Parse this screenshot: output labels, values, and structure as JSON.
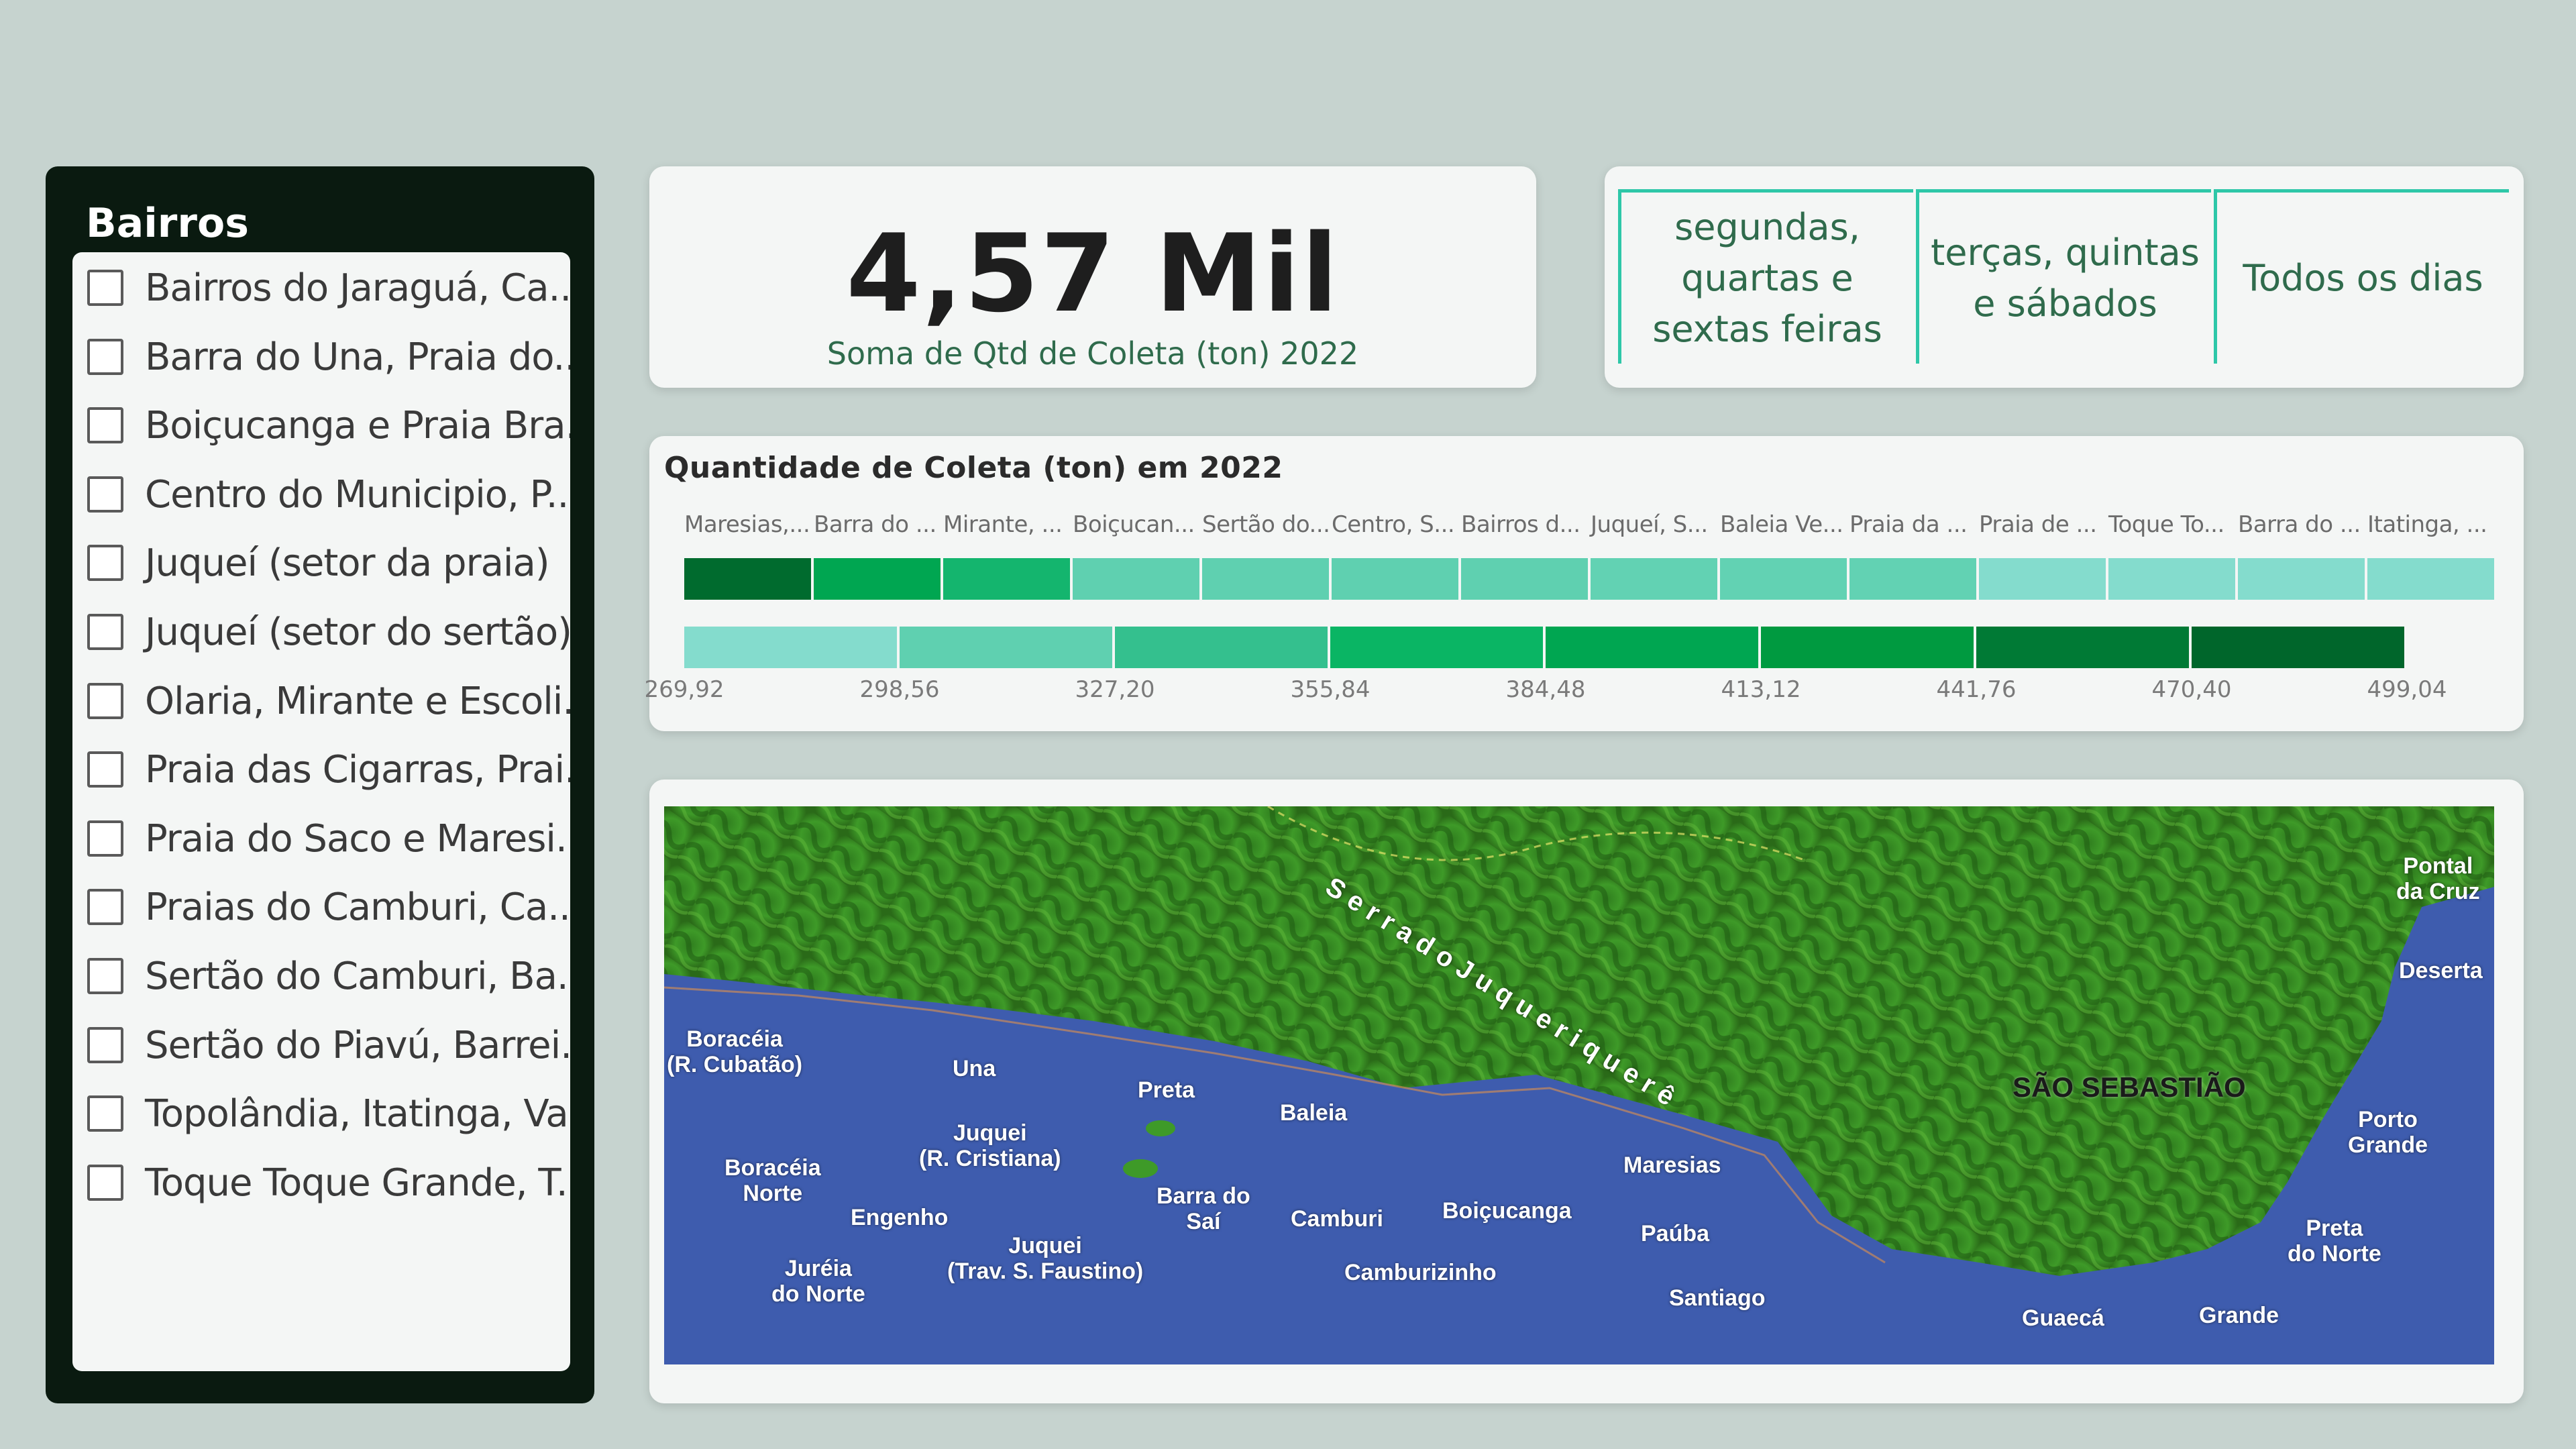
{
  "slicer": {
    "title": "Bairros",
    "items": [
      "Bairros do Jaraguá, Ca...",
      "Barra do Una, Praia do...",
      "Boiçucanga e Praia Bra...",
      "Centro do Municipio, P...",
      "Juqueí (setor da praia)",
      "Juqueí (setor do sertão)",
      "Olaria, Mirante e Escoli...",
      "Praia das Cigarras, Prai...",
      "Praia do Saco e Maresi...",
      "Praias do Camburi, Ca...",
      "Sertão do Camburi, Ba...",
      "Sertão do Piavú, Barrei...",
      "Topolândia, Itatinga, Va...",
      "Toque Toque Grande, T..."
    ]
  },
  "kpi": {
    "value": "4,57 Mil",
    "label": "Soma de Qtd de Coleta (ton) 2022"
  },
  "days": {
    "buttons": [
      "segundas,\nquartas e\nsextas feiras",
      "terças, quintas\ne sábados",
      "Todos os dias"
    ]
  },
  "heatmap": {
    "title": "Quantidade de Coleta (ton) em 2022",
    "categories": [
      "Maresias,...",
      "Barra do ...",
      "Mirante, ...",
      "Boiçucan...",
      "Sertão do...",
      "Centro, S...",
      "Bairros d...",
      "Juqueí, S...",
      "Baleia Ve...",
      "Praia da ...",
      "Praia de ...",
      "Toque To...",
      "Barra do ...",
      "Itatinga, ..."
    ],
    "cell_colors": [
      "#006b2e",
      "#00a651",
      "#14b56e",
      "#5fd0b0",
      "#5fd0b0",
      "#5fd0b0",
      "#5fd0b0",
      "#62d2b3",
      "#62d2b3",
      "#62d2b3",
      "#84dccd",
      "#84dccd",
      "#84dccd",
      "#84dccd"
    ],
    "legend_colors": [
      "#84dccd",
      "#5fd0b0",
      "#34c08e",
      "#0ab564",
      "#00a651",
      "#009a40",
      "#007a35",
      "#00662b"
    ],
    "legend_ticks": [
      "269,92",
      "298,56",
      "327,20",
      "355,84",
      "384,48",
      "413,12",
      "441,76",
      "470,40",
      "499,04"
    ]
  },
  "map": {
    "labels": [
      {
        "id": "boraceia-cubatao",
        "text": "Boracéia\n(R. Cubatão)"
      },
      {
        "id": "una",
        "text": "Una"
      },
      {
        "id": "boraceia-norte",
        "text": "Boracéia\nNorte"
      },
      {
        "id": "engenho",
        "text": "Engenho"
      },
      {
        "id": "jureia-norte",
        "text": "Juréia\ndo Norte"
      },
      {
        "id": "juquei-cristiana",
        "text": "Juquei\n(R. Cristiana)"
      },
      {
        "id": "juquei-faustino",
        "text": "Juquei\n(Trav. S. Faustino)"
      },
      {
        "id": "preta",
        "text": "Preta"
      },
      {
        "id": "barra-sai",
        "text": "Barra do\nSaí"
      },
      {
        "id": "baleia",
        "text": "Baleia"
      },
      {
        "id": "camburi",
        "text": "Camburi"
      },
      {
        "id": "camburizinho",
        "text": "Camburizinho"
      },
      {
        "id": "boicucanga",
        "text": "Boiçucanga"
      },
      {
        "id": "maresias",
        "text": "Maresias"
      },
      {
        "id": "pauba",
        "text": "Paúba"
      },
      {
        "id": "santiago",
        "text": "Santiago"
      },
      {
        "id": "guaeca",
        "text": "Guaecá"
      },
      {
        "id": "grande",
        "text": "Grande"
      },
      {
        "id": "preta-norte",
        "text": "Preta\ndo Norte"
      },
      {
        "id": "porto-grande",
        "text": "Porto\nGrande"
      },
      {
        "id": "deserta",
        "text": "Deserta"
      },
      {
        "id": "pontal-cruz",
        "text": "Pontal\nda Cruz"
      },
      {
        "id": "sao-sebastiao",
        "text": "SÃO SEBASTIÃO"
      },
      {
        "id": "serra",
        "text": "S e r r a   d o   J u q u e r i q u e r ê"
      }
    ]
  },
  "colors": {
    "accent": "#2ec7a8",
    "dark_panel": "#0a1a10",
    "background": "#c6d3cf",
    "sea": "#3e5cae"
  }
}
